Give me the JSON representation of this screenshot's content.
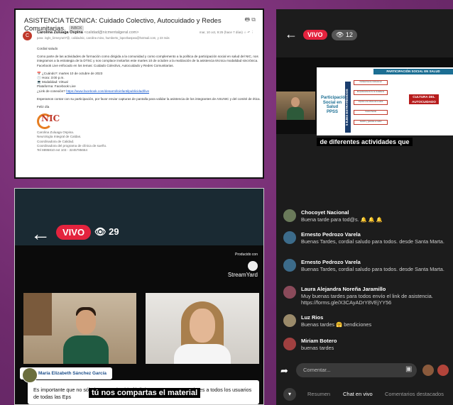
{
  "email": {
    "subject": "ASISTENCIA TECNICA: Cuidado Colectivo, Autocuidado y Redes Comunitarias.",
    "tag": "INBOX",
    "avatar_letter": "C",
    "from": "Carolina Zuluaga Ospina",
    "from_addr": "<calidad@nicmentalgeral.com>",
    "date": "mar, 10 oct, 9:25 (hace 7 días)",
    "to": "para: ingls_lizmeyra07@, calidadnic, caroline.mino, humberto_lopezbaspea@hotmail.com, y 23 más",
    "salute": "Cordial saludo",
    "paragraph": "Como parte de las actividades de formación como dirigida a la comunidad y como complemento a la política de participación social en salud del NIC, nos integramos a la estrategia de la DTSC y nos complace invitarlos este martes 10 de octubre a la  realización de la asistencia técnica modalidad sincrónica. Facebook Live enfocado en los temas: Cuidado Colectivo, Autocuidado y Redes Comunitarias.",
    "lines": [
      "📅 ¿Cuándo?: martes 10 de octubre de 2023",
      "🕒 Hora: 3:00 p.m.",
      "💻 Modalidad: Virtual",
      "Plataforma: Facebook Live"
    ],
    "link_label": "¿Link de conexión? ",
    "link_text": "https://www.facebook.com/desarrolloinfantilpublicidad/live",
    "closing_para": "Esperamos contar con su participación, por favor enviar capturas de pantalla para validar la asistencia de los integrantes de ASUNIC y del comité de ética.",
    "feliz": "Feliz día",
    "logo_text": "NIC",
    "sig": [
      "Carolina Zuluaga Ospina.",
      "Neurología Integral de Caldas.",
      "Coordinadora de Calidad.",
      "Coordinadora del programa de clínica de sueño.",
      "Tel 8895810 ext 103 - 3245785664"
    ]
  },
  "pres": {
    "back_icon": "←",
    "vivo": "VIVO",
    "views": "👁 12",
    "slide_header": "PARTICIPACIÓN SOCIAL EN SALUD",
    "slide_left": "Participación Social en Salud PPSS",
    "slide_vertical": "5 EJES ESTRATÉGICOS",
    "slide_boxes": [
      "Fortalecimiento institucional",
      "Empoderamiento de la ciudadanía",
      "Impulso a la cultura de la salud",
      "Control Social",
      "Gestión y garantía en salud"
    ],
    "slide_cultura": "CULTURA DEL AUTOCUIDADO",
    "caption": "de diferentes actividades que"
  },
  "cam": {
    "back_icon": "←",
    "vivo": "VIVO",
    "views": "👁 29",
    "produced": "Producido con",
    "streamyard": "StreamYard",
    "name": "María Elizabeth Sánchez García",
    "lower_text": "Es importante que no sólo hagamos la vida fácil de conocer como veedores a todos los usuarios de todas las Eps",
    "caption": "tú nos compartas el material"
  },
  "chat": {
    "messages": [
      {
        "name": "Chocoyet Nacional",
        "text": "Buena tarde para tod@s. 🔔 🔔 🔔"
      },
      {
        "name": "Ernesto Pedrozo Varela",
        "text": "Buenas Tardes, cordial saludo para todos. desde Santa Marta."
      },
      {
        "name": "Ernesto Pedrozo Varela",
        "text": "Buenas Tardes, cordial saludo para todos. desde Santa Marta."
      },
      {
        "name": "Laura Alejandra Noreña Jaramillo",
        "text": "Muy buenas tardes para todos envío el link de asistencia. https://forms.gle/X3CAyADrY8VEjYY56"
      },
      {
        "name": "Luz Rios",
        "text": "Buenas tardes 🤗 bendiciones"
      },
      {
        "name": "Miriam Botero",
        "text": "buenas tardes"
      }
    ],
    "comment_placeholder": "Comentar...",
    "tabs": [
      "Resumen",
      "Chat en vivo",
      "Comentarios destacados"
    ]
  }
}
